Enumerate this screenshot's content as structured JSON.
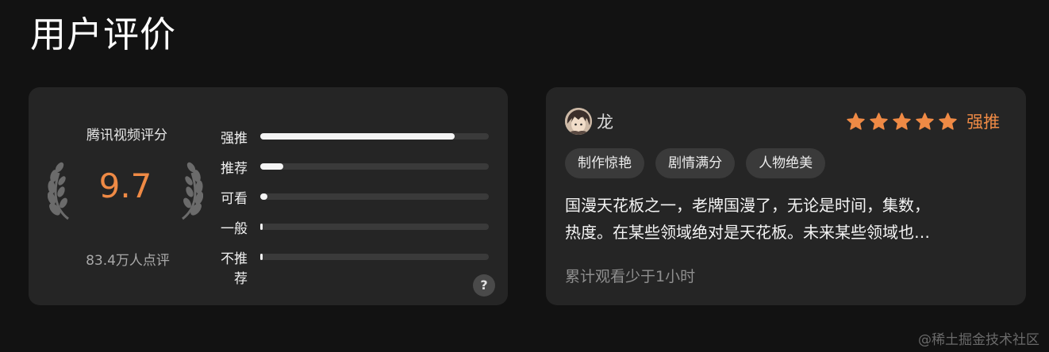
{
  "section_title": "用户评价",
  "rating": {
    "source_label": "腾讯视频评分",
    "score": "9.7",
    "review_count": "83.4万人点评",
    "help_label": "?",
    "bars": [
      {
        "label": "强推",
        "fraction": 0.85
      },
      {
        "label": "推荐",
        "fraction": 0.1
      },
      {
        "label": "可看",
        "fraction": 0.03
      },
      {
        "label": "一般",
        "fraction": 0.01
      },
      {
        "label": "不推荐",
        "fraction": 0.01
      }
    ],
    "colors": {
      "score": "#ef8a45",
      "bar_fill": "#f4f4f4",
      "bar_track": "#3a3a3a"
    }
  },
  "review": {
    "user_name": "龙",
    "star_count": 5,
    "rating_label": "强推",
    "tags": [
      "制作惊艳",
      "剧情满分",
      "人物绝美"
    ],
    "text_line_1": "国漫天花板之一，老牌国漫了，无论是时间，集数，",
    "text_line_2": "热度。在某些领域绝对是天花板。未来某些领域也…",
    "watch_time": "累计观看少于1小时",
    "colors": {
      "accent": "#ef8a45"
    }
  },
  "watermark": "@稀土掘金技术社区"
}
